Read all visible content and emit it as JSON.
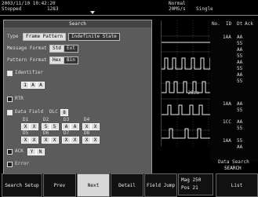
{
  "header": {
    "datetime": "2003/11/10 10:42:20",
    "status": "Stopped",
    "count": "1283",
    "mode": "Normal",
    "sample_rate": "20MS/s",
    "single": "Single"
  },
  "dialog": {
    "title": "Search",
    "type_label": "Type",
    "type_options": [
      "Frame Pattern",
      "Indefinite State"
    ],
    "message_format_label": "Message Format",
    "message_format_options": [
      "Std",
      "Ext"
    ],
    "pattern_format_label": "Pattern Format",
    "pattern_format_options": [
      "Hex",
      "Bin"
    ],
    "identifier_label": "Identifier",
    "identifier_digits": [
      "1",
      "A",
      "A"
    ],
    "rtr_label": "RTR",
    "data_field_label": "Data Field",
    "dlc_label": "DLC",
    "dlc_value": "8",
    "byte_headers_row1": [
      "D1",
      "D2",
      "D3",
      "D4"
    ],
    "byte_values_row1": [
      "X",
      "X",
      "5",
      "5",
      "A",
      "A",
      "X",
      "X"
    ],
    "byte_headers_row2": [
      "D5",
      "D6",
      "D7",
      "D8"
    ],
    "byte_values_row2": [
      "X",
      "X",
      "X",
      "X",
      "X",
      "X",
      "X",
      "X"
    ],
    "ack_label": "ACK",
    "ack_value": "Y",
    "ack_value2": "N",
    "error_label": "Error"
  },
  "right_panel": {
    "columns": [
      "No.",
      "ID",
      "Dt",
      "Ack"
    ],
    "groups": [
      {
        "id": "1AA",
        "values": [
          "AA",
          "55",
          "AA",
          "55",
          "AA",
          "55",
          "AA",
          "55"
        ]
      },
      {
        "id": "1AA",
        "values": [
          "AA",
          "55"
        ]
      },
      {
        "id": "1CC",
        "values": [
          "AA",
          "55"
        ]
      },
      {
        "id": "1AA",
        "values": [
          "55",
          "AA"
        ]
      }
    ],
    "time_marker": "-20ms",
    "data_search": "Data Search",
    "search": "SEARCH"
  },
  "softkeys": {
    "search_setup": "Search Setup",
    "prev": "Prev",
    "next": "Next",
    "detail": "Detail",
    "field_jump": "Field Jump",
    "mag_label": "Mag",
    "mag_value": "250",
    "pos_label": "Pos",
    "pos_value": "21",
    "list": "List"
  }
}
